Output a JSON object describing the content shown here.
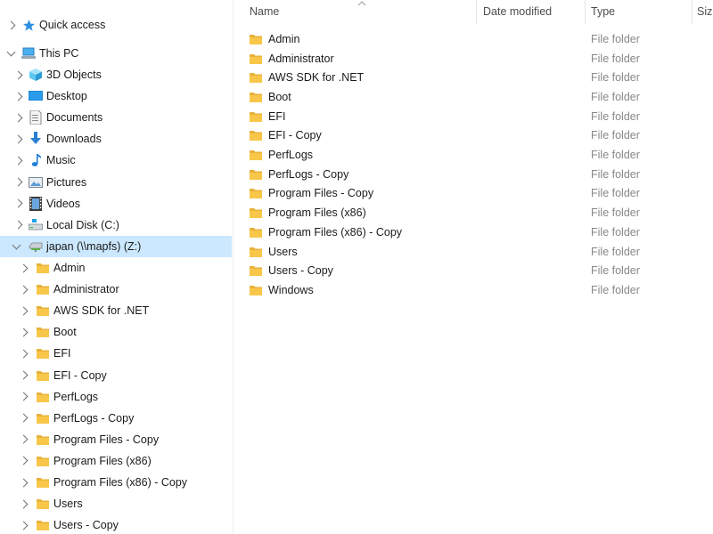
{
  "nav": {
    "quick_access": "Quick access",
    "this_pc": "This PC",
    "this_pc_children": [
      {
        "label": "3D Objects",
        "icon": "3d-objects-icon"
      },
      {
        "label": "Desktop",
        "icon": "desktop-icon"
      },
      {
        "label": "Documents",
        "icon": "documents-icon"
      },
      {
        "label": "Downloads",
        "icon": "downloads-icon"
      },
      {
        "label": "Music",
        "icon": "music-icon"
      },
      {
        "label": "Pictures",
        "icon": "pictures-icon"
      },
      {
        "label": "Videos",
        "icon": "videos-icon"
      },
      {
        "label": "Local Disk (C:)",
        "icon": "local-disk-icon"
      }
    ],
    "network_drive": "japan (\\\\mapfs) (Z:)",
    "drive_children": [
      "Admin",
      "Administrator",
      "AWS SDK for .NET",
      "Boot",
      "EFI",
      "EFI - Copy",
      "PerfLogs",
      "PerfLogs - Copy",
      "Program Files - Copy",
      "Program Files (x86)",
      "Program Files (x86) - Copy",
      "Users",
      "Users - Copy"
    ]
  },
  "columns": {
    "name": "Name",
    "date_modified": "Date modified",
    "type": "Type",
    "size": "Size"
  },
  "files": [
    {
      "name": "Admin",
      "type": "File folder"
    },
    {
      "name": "Administrator",
      "type": "File folder"
    },
    {
      "name": "AWS SDK for .NET",
      "type": "File folder"
    },
    {
      "name": "Boot",
      "type": "File folder"
    },
    {
      "name": "EFI",
      "type": "File folder"
    },
    {
      "name": "EFI - Copy",
      "type": "File folder"
    },
    {
      "name": "PerfLogs",
      "type": "File folder"
    },
    {
      "name": "PerfLogs - Copy",
      "type": "File folder"
    },
    {
      "name": "Program Files - Copy",
      "type": "File folder"
    },
    {
      "name": "Program Files (x86)",
      "type": "File folder"
    },
    {
      "name": "Program Files (x86) - Copy",
      "type": "File folder"
    },
    {
      "name": "Users",
      "type": "File folder"
    },
    {
      "name": "Users - Copy",
      "type": "File folder"
    },
    {
      "name": "Windows",
      "type": "File folder"
    }
  ],
  "colors": {
    "selection": "#cce8ff",
    "folder": "#f8c74a",
    "type_text": "#888888"
  }
}
